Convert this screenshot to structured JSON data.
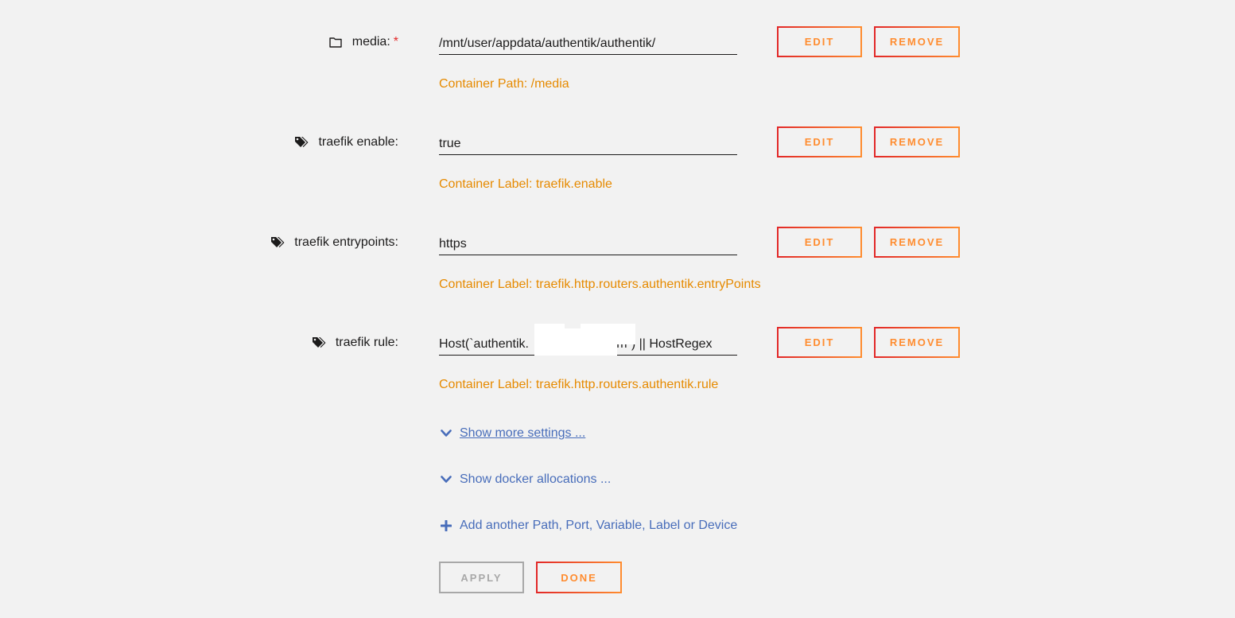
{
  "rows": [
    {
      "label": "media:",
      "required_mark": "*",
      "icon": "folder-icon",
      "value": "/mnt/user/appdata/authentik/authentik/",
      "hint": "Container Path: /media"
    },
    {
      "label": "traefik enable:",
      "icon": "tags-icon",
      "value": "true",
      "hint": "Container Label: traefik.enable"
    },
    {
      "label": "traefik entrypoints:",
      "icon": "tags-icon",
      "value": "https",
      "hint": "Container Label: traefik.http.routers.authentik.entryPoints"
    },
    {
      "label": "traefik rule:",
      "icon": "tags-icon",
      "value": "Host(`authentik.                    .com`) || HostRegex",
      "hint": "Container Label: traefik.http.routers.authentik.rule"
    }
  ],
  "buttons": {
    "edit": "EDIT",
    "remove": "REMOVE",
    "apply": "APPLY",
    "done": "DONE"
  },
  "links": {
    "show_more_settings": "Show more settings ...",
    "show_docker_allocations": "Show docker allocations ...",
    "add_another": "Add another Path, Port, Variable, Label or Device"
  },
  "colors": {
    "hint": "#e68a00",
    "link": "#486dba",
    "accent_start": "#e22828",
    "accent_end": "#ff8c2f",
    "disabled": "#a8a8a8"
  }
}
